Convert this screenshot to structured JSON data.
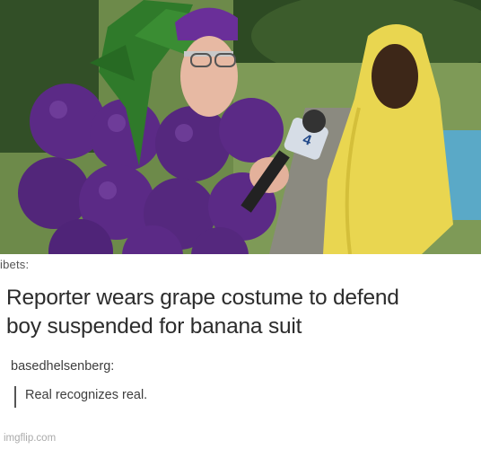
{
  "image": {
    "scene": "Interview photo: older man in purple grape costume holding a microphone toward a boy in a yellow banana costume",
    "colors": {
      "grape": "#5b2a86",
      "leaf": "#2f7a2a",
      "banana": "#e9d650",
      "grass": "#6f8f48"
    }
  },
  "post": {
    "cut_username": "ibets:",
    "headline_line1": "Reporter wears grape costume to defend",
    "headline_line2": "boy suspended for banana suit",
    "reply_username": "basedhelsenberg:",
    "reply_text": "Real recognizes real."
  },
  "watermark": "imgflip.com"
}
